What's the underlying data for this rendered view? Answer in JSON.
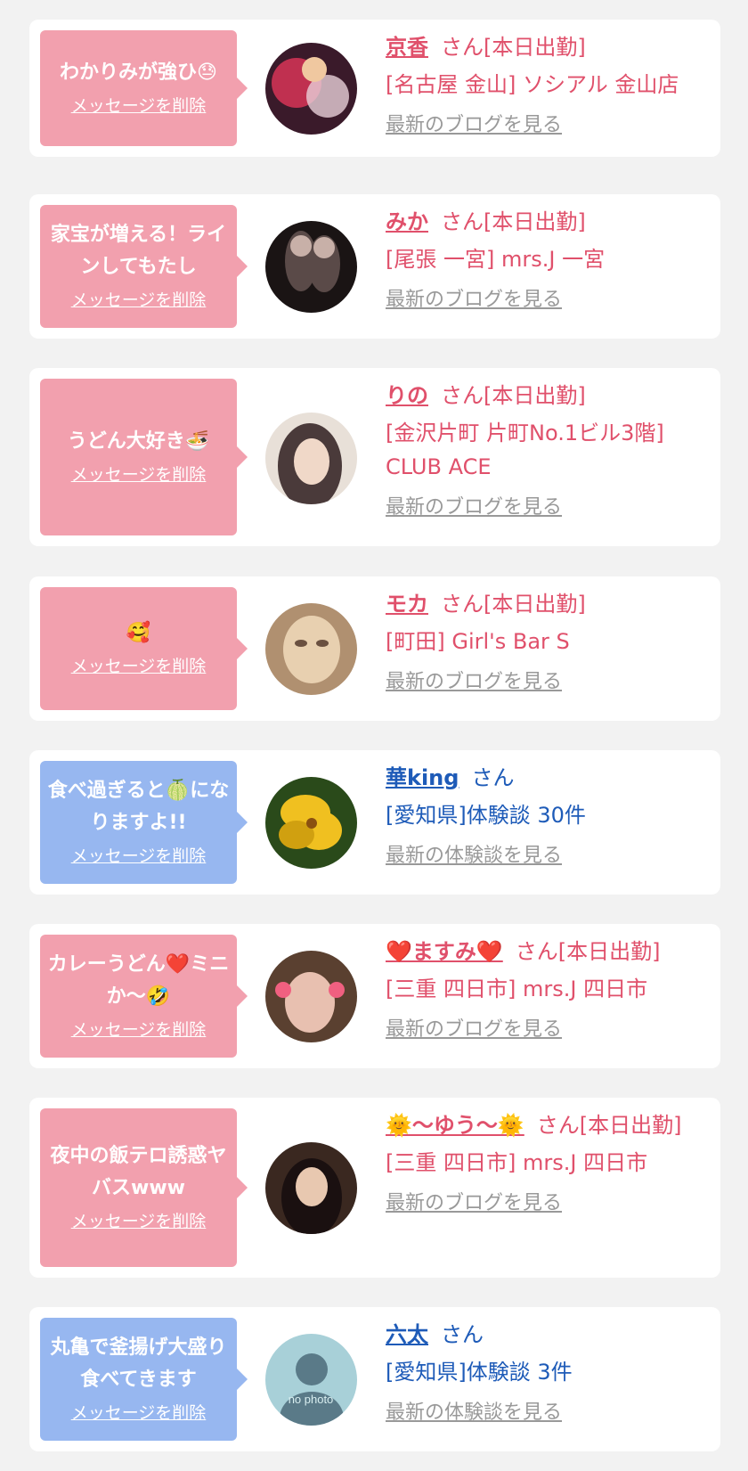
{
  "cards": [
    {
      "type": "cast",
      "message": "わかりみが強ひ😓",
      "delete_label": "メッセージを削除",
      "name": "京香",
      "suffix": "さん[本日出勤]",
      "shop": "[名古屋 金山] ソシアル 金山店",
      "blog_label": "最新のブログを見る",
      "avatar_colors": [
        "#3a1a2a",
        "#c03050",
        "#e8d0d8"
      ]
    },
    {
      "type": "cast",
      "message": "家宝が増える！ラインしてもたし",
      "delete_label": "メッセージを削除",
      "name": "みか",
      "suffix": "さん[本日出勤]",
      "shop": "[尾張 一宮] mrs.J 一宮",
      "blog_label": "最新のブログを見る",
      "avatar_colors": [
        "#1a1414",
        "#5a4a48",
        "#c8b0a8"
      ]
    },
    {
      "type": "cast",
      "message": "うどん大好き🍜",
      "delete_label": "メッセージを削除",
      "name": "りの",
      "suffix": "さん[本日出勤]",
      "shop": "[金沢片町 片町No.1ビル3階] CLUB ACE",
      "blog_label": "最新のブログを見る",
      "avatar_colors": [
        "#e8e0d8",
        "#4a3a3a",
        "#f0d8c8"
      ]
    },
    {
      "type": "cast",
      "message": "🥰",
      "delete_label": "メッセージを削除",
      "name": "モカ",
      "suffix": "さん[本日出勤]",
      "shop": "[町田] Girl's Bar S",
      "blog_label": "最新のブログを見る",
      "avatar_colors": [
        "#b09070",
        "#e8d0b0",
        "#6a5040"
      ]
    },
    {
      "type": "user",
      "message": "食べ過ぎると🍈になりますよ!!",
      "delete_label": "メッセージを削除",
      "name": "華king",
      "suffix": "さん",
      "shop": "[愛知県]体験談 30件",
      "blog_label": "最新の体験談を見る",
      "avatar_colors": [
        "#2a4a1a",
        "#f0c020",
        "#d0a010"
      ]
    },
    {
      "type": "cast",
      "message": "カレーうどん❤️ミニか〜🤣",
      "delete_label": "メッセージを削除",
      "name": "❤️ますみ❤️",
      "suffix": "さん[本日出勤]",
      "shop": "[三重 四日市] mrs.J 四日市",
      "blog_label": "最新のブログを見る",
      "avatar_colors": [
        "#5a4030",
        "#e8c0b0",
        "#f06080"
      ]
    },
    {
      "type": "cast",
      "message": "夜中の飯テロ誘惑ヤバスwww",
      "delete_label": "メッセージを削除",
      "name": "🌞〜ゆう〜🌞",
      "suffix": "さん[本日出勤]",
      "shop": "[三重 四日市] mrs.J 四日市",
      "blog_label": "最新のブログを見る",
      "avatar_colors": [
        "#3a2820",
        "#e8c8b0",
        "#1a1010"
      ]
    },
    {
      "type": "user",
      "message": "丸亀で釜揚げ大盛り食べてきます",
      "delete_label": "メッセージを削除",
      "name": "六太",
      "suffix": "さん",
      "shop": "[愛知県]体験談 3件",
      "blog_label": "最新の体験談を見る",
      "avatar_colors": [
        "#a8d0d8",
        "#5a7a88",
        "#d8eef0"
      ],
      "avatar_text": "no photo"
    }
  ]
}
